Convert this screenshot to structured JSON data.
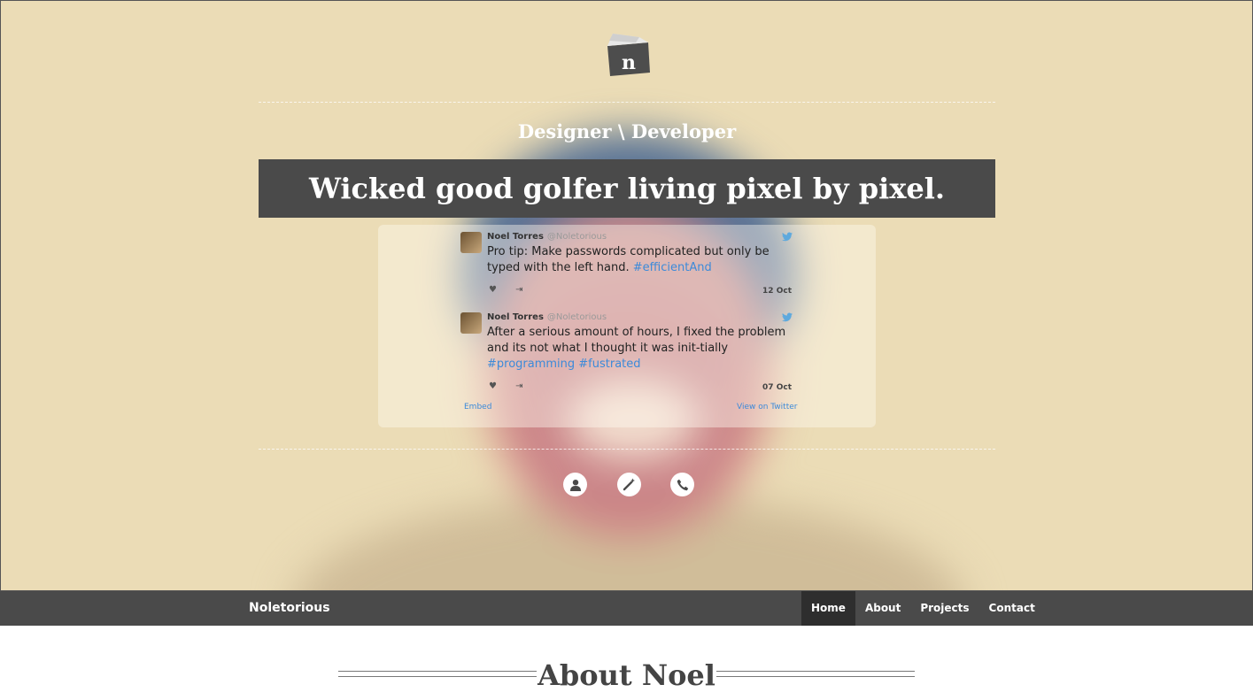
{
  "hero": {
    "tagline": "Designer \\ Developer",
    "headline": "Wicked good golfer living pixel by pixel."
  },
  "tweets": [
    {
      "name": "Noel Torres",
      "handle": "@Noletorious",
      "text": "Pro tip: Make passwords complicated but only be typed with the left hand. ",
      "hashtags": "#efficientAnd",
      "date": "12 Oct"
    },
    {
      "name": "Noel Torres",
      "handle": "@Noletorious",
      "text": "After a serious amount of hours, I fixed the problem and its not what I thought it was init-tially ",
      "hashtags": "#programming #fustrated",
      "date": "07 Oct"
    }
  ],
  "timeline": {
    "embed": "Embed",
    "view_on_twitter": "View on Twitter"
  },
  "icons": [
    "user-icon",
    "magic-wand-icon",
    "phone-icon",
    "twitter-bird-icon",
    "heart-icon",
    "retweet-icon"
  ],
  "nav": {
    "brand": "Noletorious",
    "items": [
      "Home",
      "About",
      "Projects",
      "Contact"
    ],
    "active": "Home"
  },
  "about": {
    "title": "About Noel"
  },
  "colors": {
    "bar": "#4a4a4a",
    "active_nav": "#2e2e2e",
    "hero_bg": "#ebdcb6",
    "link": "#3c8ad9"
  }
}
